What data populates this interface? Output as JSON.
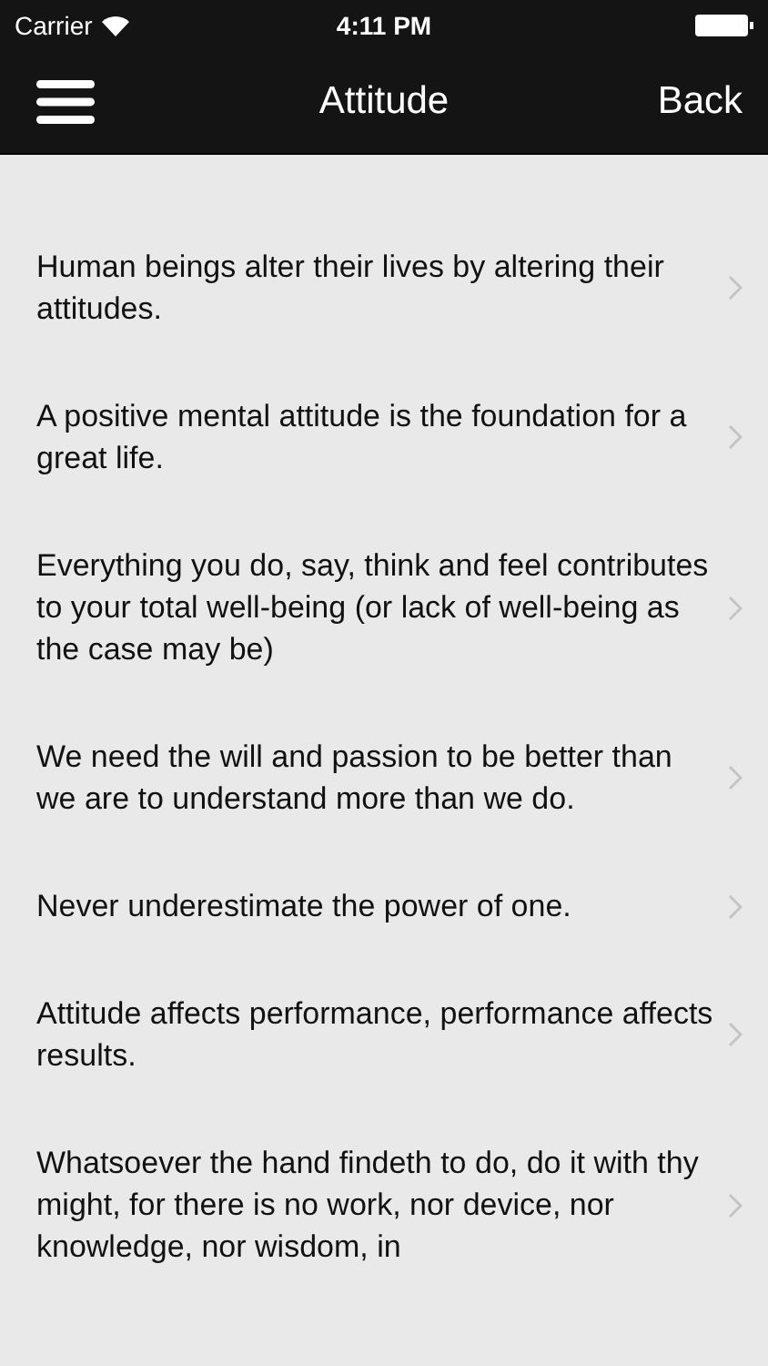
{
  "status_bar": {
    "carrier": "Carrier",
    "time": "4:11 PM"
  },
  "nav_bar": {
    "title": "Attitude",
    "back": "Back"
  },
  "quotes": [
    {
      "text": "Human beings alter their lives by altering their attitudes."
    },
    {
      "text": "A positive mental attitude is the foundation for a great life."
    },
    {
      "text": "Everything you do, say, think and feel contributes to your total well-being (or lack of well-being as the case may be)"
    },
    {
      "text": "We need the will and passion to be better than we are to understand more than we do."
    },
    {
      "text": "Never underestimate the power of one."
    },
    {
      "text": "Attitude affects performance, performance affects results."
    },
    {
      "text": "Whatsoever the hand findeth to do, do it with thy might, for there is no work, nor device, nor knowledge, nor wisdom, in"
    }
  ]
}
